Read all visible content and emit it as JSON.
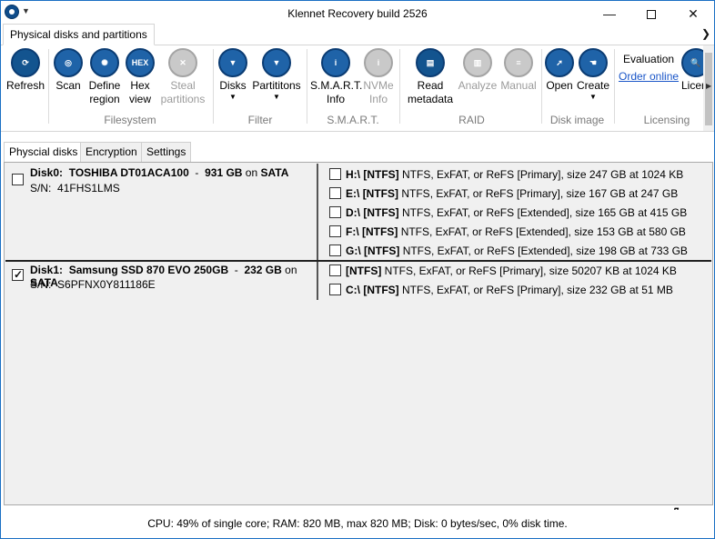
{
  "window": {
    "title": "Klennet Recovery build 2526",
    "min_glyph": "—",
    "close_glyph": "✕"
  },
  "ribbon_tab": "Physical disks and partitions",
  "ribbon": {
    "buttons": {
      "refresh": "Refresh",
      "scan": "Scan",
      "define1": "Define",
      "define2": "region",
      "hex1": "Hex",
      "hex2": "view",
      "steal1": "Steal",
      "steal2": "partitions",
      "disks": "Disks",
      "partitions": "Partititons",
      "smart1": "S.M.A.R.T.",
      "smart2": "Info",
      "nvme1": "NVMe",
      "nvme2": "Info",
      "read1": "Read",
      "read2": "metadata",
      "analyze": "Analyze",
      "manual": "Manual",
      "open": "Open",
      "create": "Create",
      "licence": "Licer"
    },
    "hex_icon_text": "HEX",
    "groups": {
      "filesystem": "Filesystem",
      "filter": "Filter",
      "smart": "S.M.A.R.T.",
      "raid": "RAID",
      "disk_image": "Disk image",
      "licensing": "Licensing"
    },
    "evaluation": "Evaluation",
    "order_online": "Order online"
  },
  "content_tabs": [
    "Physcial disks",
    "Encryption",
    "Settings"
  ],
  "disks": [
    {
      "checked": false,
      "name": "Disk0:",
      "model": "TOSHIBA DT01ACA100",
      "size": "931 GB",
      "on": "on",
      "bus": "SATA",
      "sn_label": "S/N:",
      "sn": "41FHS1LMS",
      "partitions": [
        {
          "drive": "H:\\",
          "fs": "[NTFS]",
          "desc": "NTFS, ExFAT, or ReFS [Primary], size 247 GB at 1024 KB"
        },
        {
          "drive": "E:\\",
          "fs": "[NTFS]",
          "desc": "NTFS, ExFAT, or ReFS [Primary], size 167 GB at 247 GB"
        },
        {
          "drive": "D:\\",
          "fs": "[NTFS]",
          "desc": "NTFS, ExFAT, or ReFS [Extended], size 165 GB at 415 GB"
        },
        {
          "drive": "F:\\",
          "fs": "[NTFS]",
          "desc": "NTFS, ExFAT, or ReFS [Extended], size 153 GB at 580 GB"
        },
        {
          "drive": "G:\\",
          "fs": "[NTFS]",
          "desc": "NTFS, ExFAT, or ReFS [Extended], size 198 GB at 733 GB"
        }
      ]
    },
    {
      "checked": true,
      "name": "Disk1:",
      "model": "Samsung SSD 870 EVO 250GB",
      "size": "232 GB",
      "on": "on",
      "bus": "SATA",
      "sn_label": "S/N:",
      "sn": "S6PFNX0Y811186E",
      "partitions": [
        {
          "drive": "",
          "fs": "[NTFS]",
          "desc": "NTFS, ExFAT, or ReFS [Primary], size 50207 KB at 1024 KB"
        },
        {
          "drive": "C:\\",
          "fs": "[NTFS]",
          "desc": "NTFS, ExFAT, or ReFS [Primary], size 232 GB at 51 MB"
        }
      ]
    }
  ],
  "status": "CPU: 49% of single core; RAM: 820 MB, max 820 MB; Disk: 0 bytes/sec, 0% disk time."
}
